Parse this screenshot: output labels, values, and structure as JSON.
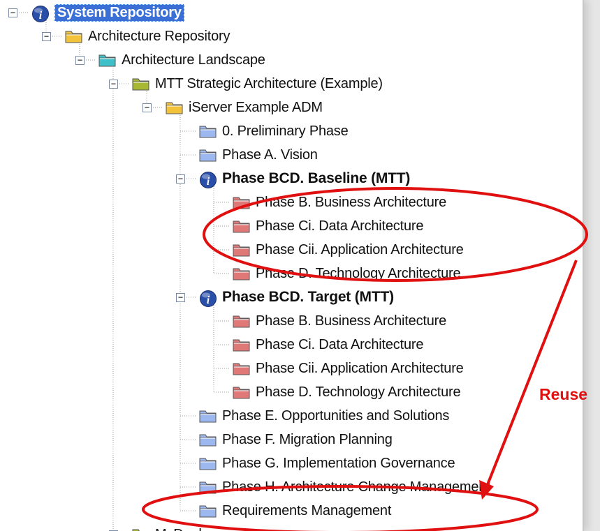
{
  "tree": {
    "nodes": [
      {
        "label": "System Repository",
        "level": 0,
        "icon": "info-icon",
        "toggle": "minus",
        "selected": true
      },
      {
        "label": "Architecture Repository",
        "level": 1,
        "icon": "folder-yellow-icon",
        "toggle": "minus"
      },
      {
        "label": "Architecture Landscape",
        "level": 2,
        "icon": "folder-teal-icon",
        "toggle": "minus"
      },
      {
        "label": "MTT Strategic Architecture (Example)",
        "level": 3,
        "icon": "folder-olive-icon",
        "toggle": "minus"
      },
      {
        "label": "iServer Example ADM",
        "level": 4,
        "icon": "folder-yellow-icon",
        "toggle": "minus"
      },
      {
        "label": "0. Preliminary Phase",
        "level": 5,
        "icon": "folder-blue-icon",
        "toggle": "none"
      },
      {
        "label": "Phase A. Vision",
        "level": 5,
        "icon": "folder-blue-icon",
        "toggle": "none"
      },
      {
        "label": "Phase BCD. Baseline (MTT)",
        "level": 5,
        "icon": "info-icon",
        "toggle": "minus",
        "bold": true
      },
      {
        "label": "Phase B. Business Architecture",
        "level": 6,
        "icon": "folder-red-icon",
        "toggle": "none"
      },
      {
        "label": "Phase Ci. Data Architecture",
        "level": 6,
        "icon": "folder-red-icon",
        "toggle": "none"
      },
      {
        "label": "Phase Cii. Application Architecture",
        "level": 6,
        "icon": "folder-red-icon",
        "toggle": "none"
      },
      {
        "label": "Phase D. Technology Architecture",
        "level": 6,
        "icon": "folder-red-icon",
        "toggle": "none"
      },
      {
        "label": "Phase BCD. Target (MTT)",
        "level": 5,
        "icon": "info-icon",
        "toggle": "minus",
        "bold": true
      },
      {
        "label": "Phase B. Business Architecture",
        "level": 6,
        "icon": "folder-red-icon",
        "toggle": "none"
      },
      {
        "label": "Phase Ci. Data Architecture",
        "level": 6,
        "icon": "folder-red-icon",
        "toggle": "none"
      },
      {
        "label": "Phase Cii. Application Architecture",
        "level": 6,
        "icon": "folder-red-icon",
        "toggle": "none"
      },
      {
        "label": "Phase D. Technology Architecture",
        "level": 6,
        "icon": "folder-red-icon",
        "toggle": "none"
      },
      {
        "label": "Phase E. Opportunities and Solutions",
        "level": 5,
        "icon": "folder-blue-icon",
        "toggle": "none"
      },
      {
        "label": "Phase F. Migration Planning",
        "level": 5,
        "icon": "folder-blue-icon",
        "toggle": "none"
      },
      {
        "label": "Phase G. Implementation Governance",
        "level": 5,
        "icon": "folder-blue-icon",
        "toggle": "none"
      },
      {
        "label": "Phase H. Architecture Change Management",
        "level": 5,
        "icon": "folder-blue-icon",
        "toggle": "none"
      },
      {
        "label": "Requirements Management",
        "level": 5,
        "icon": "folder-blue-icon",
        "toggle": "none"
      },
      {
        "label": "MyDeals",
        "level": 3,
        "icon": "folder-olive-icon",
        "toggle": "plus"
      }
    ]
  },
  "annotations": {
    "reuse_label": "Reuse",
    "color": "#e01010"
  },
  "colors": {
    "selection": "#3a70d6",
    "folder_yellow": "#f2c23a",
    "folder_teal": "#3ec0c8",
    "folder_olive": "#a8b833",
    "folder_blue": "#9db8ee",
    "folder_red": "#e07878",
    "info": "#2a4fa8"
  }
}
